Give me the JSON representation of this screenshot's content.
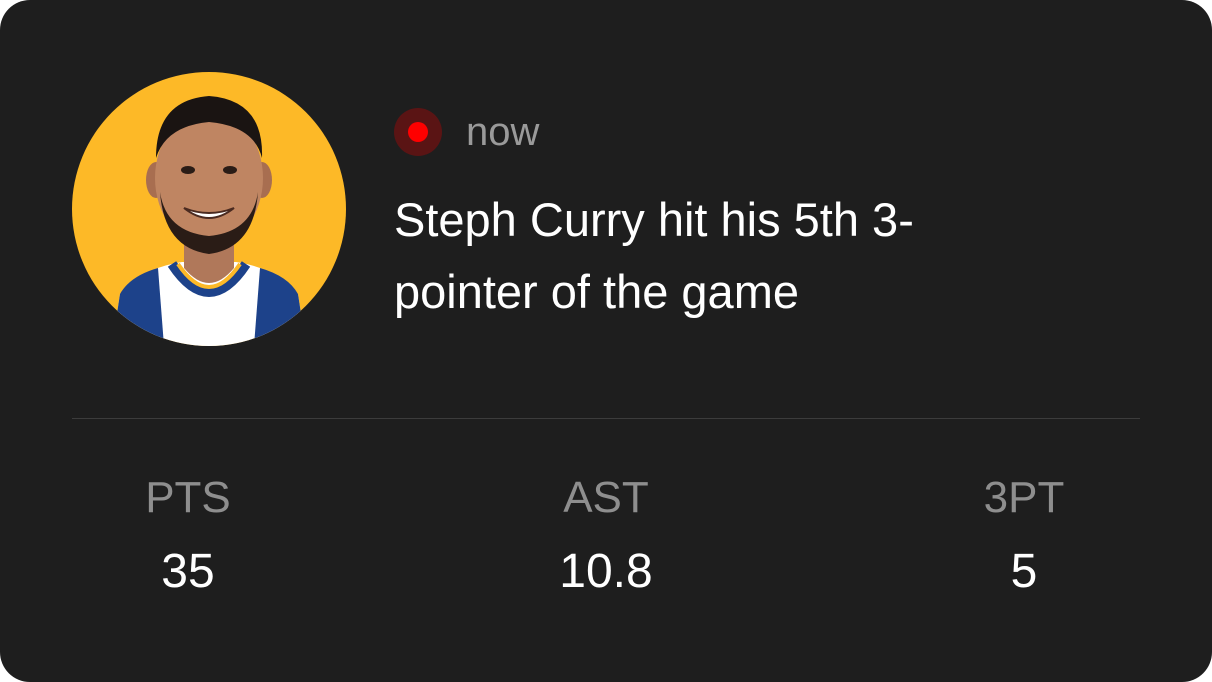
{
  "notification": {
    "timestamp": "now",
    "headline": "Steph Curry hit his 5th 3-pointer of the game",
    "live_color": "#ff0000",
    "avatar": {
      "icon": "player-avatar-icon",
      "background_color": "#fdb927",
      "jersey_color": "#ffffff",
      "trim_color": "#1d428a"
    }
  },
  "stats": [
    {
      "label": "PTS",
      "value": "35"
    },
    {
      "label": "AST",
      "value": "10.8"
    },
    {
      "label": "3PT",
      "value": "5"
    }
  ],
  "colors": {
    "card_background": "#1e1e1e",
    "text_primary": "#ffffff",
    "text_secondary": "#8e8e8e"
  }
}
